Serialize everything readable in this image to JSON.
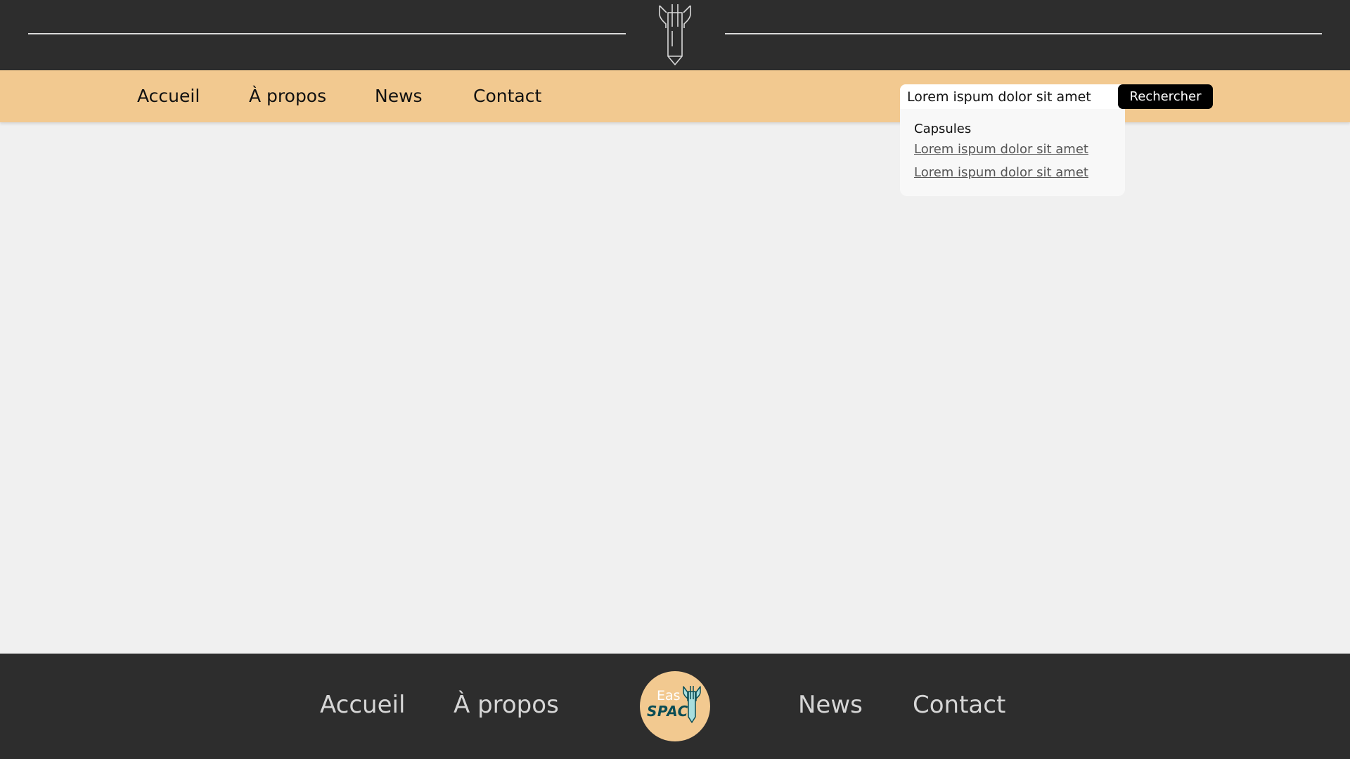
{
  "nav": {
    "items": [
      {
        "label": "Accueil"
      },
      {
        "label": "À propos"
      },
      {
        "label": "News"
      },
      {
        "label": "Contact"
      }
    ]
  },
  "search": {
    "value": "Lorem ispum dolor sit amet",
    "button_label": "Rechercher",
    "dropdown": {
      "section_title": "Capsules",
      "results": [
        {
          "label": "Lorem ispum dolor sit amet"
        },
        {
          "label": "Lorem ispum dolor sit amet"
        }
      ]
    }
  },
  "footer": {
    "items": [
      {
        "label": "Accueil"
      },
      {
        "label": "À propos"
      },
      {
        "label": "News"
      },
      {
        "label": "Contact"
      }
    ],
    "logo": {
      "line1": "Eas",
      "line2": "SPAC"
    }
  },
  "colors": {
    "header_bg": "#2d2d2d",
    "navbar_bg": "#f2c990",
    "page_bg": "#f0f0f0",
    "footer_bg": "#2d2d2d",
    "logo_teal": "#0b4d55",
    "logo_light": "#a8dede"
  },
  "icons": {
    "header_logo": "rocket-icon",
    "footer_logo": "easyspace-logo"
  }
}
